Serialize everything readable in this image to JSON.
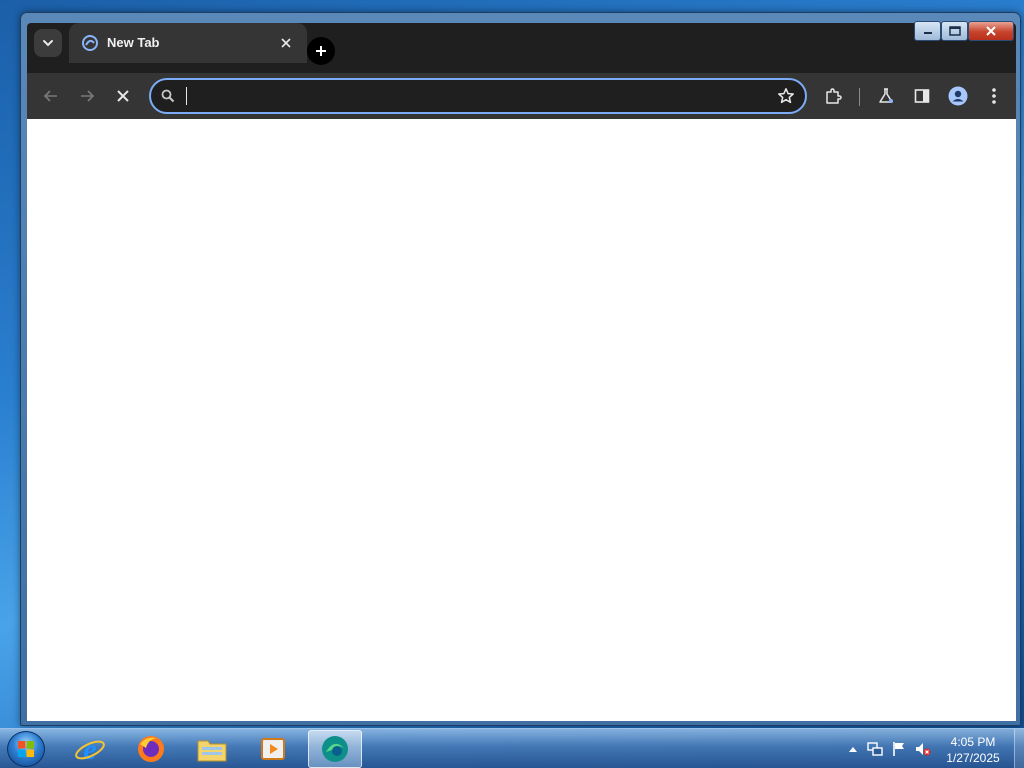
{
  "browser": {
    "tab": {
      "title": "New Tab",
      "favicon": "edge-favicon-icon"
    },
    "omnibox": {
      "value": "",
      "placeholder": ""
    },
    "icons": {
      "tab_search": "chevron-down-icon",
      "new_tab": "plus-icon",
      "back": "arrow-left-icon",
      "forward": "arrow-right-icon",
      "stop": "close-icon",
      "bookmark": "star-icon",
      "extensions": "puzzle-icon",
      "labs": "flask-icon",
      "side_panel": "side-panel-icon",
      "profile": "profile-icon",
      "menu": "more-vertical-icon"
    }
  },
  "taskbar": {
    "apps": [
      "internet-explorer",
      "firefox",
      "file-explorer",
      "media-player",
      "browser"
    ],
    "clock": {
      "time": "4:05 PM",
      "date": "1/27/2025"
    }
  },
  "colors": {
    "accent": "#7cacf8",
    "toolbar": "#353535",
    "tabstrip": "#1f1f1f",
    "taskbar": "#2b5a94"
  }
}
